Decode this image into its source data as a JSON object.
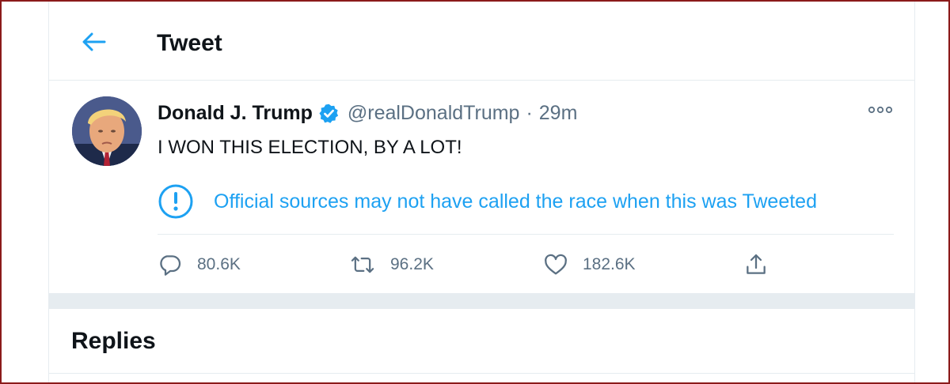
{
  "header": {
    "title": "Tweet",
    "back_icon": "arrow-left-icon"
  },
  "tweet": {
    "author_name": "Donald J. Trump",
    "verified_icon": "verified-badge-icon",
    "handle": "@realDonaldTrump",
    "separator": "·",
    "time": "29m",
    "more_icon": "more-horizontal-icon",
    "text": "I WON THIS ELECTION, BY A LOT!",
    "notice": {
      "icon": "alert-circle-icon",
      "text": "Official sources may not have called the race when this was Tweeted"
    },
    "actions": {
      "reply": {
        "icon": "reply-icon",
        "count": "80.6K"
      },
      "retweet": {
        "icon": "retweet-icon",
        "count": "96.2K"
      },
      "like": {
        "icon": "heart-icon",
        "count": "182.6K"
      },
      "share": {
        "icon": "share-icon"
      }
    }
  },
  "replies": {
    "title": "Replies"
  },
  "colors": {
    "accent": "#1da1f2",
    "secondary_text": "#5b7083",
    "primary_text": "#0f1419",
    "divider": "#e6ecf0",
    "frame": "#8b1a1a"
  }
}
